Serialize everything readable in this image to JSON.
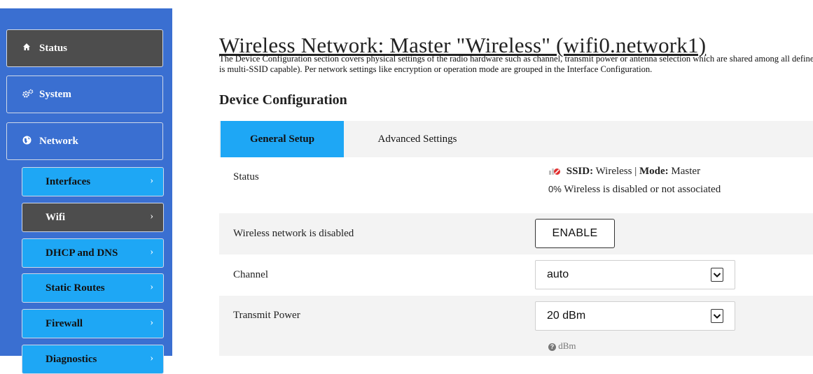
{
  "sidebar": {
    "main_items": [
      {
        "label": "Status",
        "icon": "home-icon"
      },
      {
        "label": "System",
        "icon": "gears-icon"
      },
      {
        "label": "Network",
        "icon": "globe-icon"
      }
    ],
    "sub_items": [
      {
        "label": "Interfaces"
      },
      {
        "label": "Wifi"
      },
      {
        "label": "DHCP and DNS"
      },
      {
        "label": "Static Routes"
      },
      {
        "label": "Firewall"
      },
      {
        "label": "Diagnostics"
      }
    ],
    "chevron": "›"
  },
  "page": {
    "title": "Wireless Network: Master \"Wireless\" (wifi0.network1)",
    "description_line1": "The Device Configuration section covers physical settings of the radio hardware such as channel, transmit power or antenna selection which are shared among all defined wireless networks (if the radio hardware",
    "description_line2": "is multi-SSID capable). Per network settings like encryption or operation mode are grouped in the Interface Configuration."
  },
  "device_config": {
    "title": "Device Configuration",
    "tabs": [
      "General Setup",
      "Advanced Settings"
    ],
    "status": {
      "label": "Status",
      "ssid_key": "SSID:",
      "ssid_value": "Wireless",
      "separator": "|",
      "mode_key": "Mode:",
      "mode_value": "Master",
      "percent": "0%",
      "message": "Wireless is disabled or not associated"
    },
    "disabled_row": {
      "label": "Wireless network is disabled",
      "button": "ENABLE"
    },
    "channel": {
      "label": "Channel",
      "value": "auto"
    },
    "tx_power": {
      "label": "Transmit Power",
      "value": "20 dBm",
      "hint": "dBm"
    }
  },
  "colors": {
    "sidebar": "#3a6fd1",
    "accent": "#1ea7f5",
    "active_dark": "#4d4d4d"
  }
}
